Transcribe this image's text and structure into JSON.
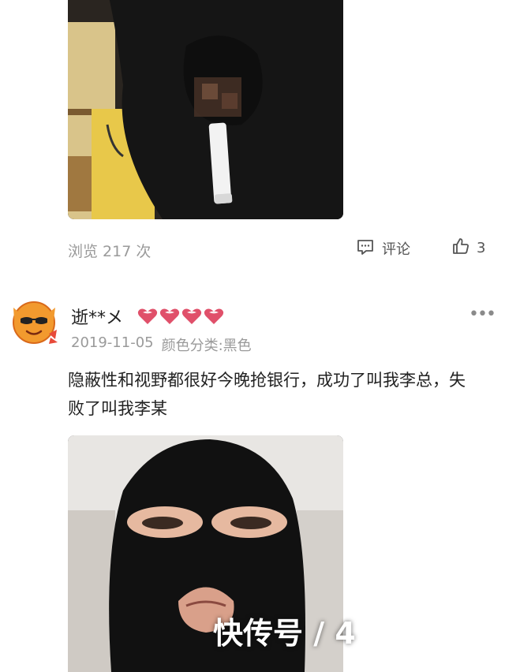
{
  "post": {
    "views_label": "浏览 217 次",
    "comment_label": "评论",
    "like_count": "3"
  },
  "review": {
    "username": "逝**メ",
    "hearts_count": 4,
    "date": "2019-11-05",
    "variant_label": "颜色分类:黑色",
    "text": "隐蔽性和视野都很好今晚抢银行，成功了叫我李总，失败了叫我李某"
  },
  "watermark": "快传号 / 4",
  "colors": {
    "heart": "#e0506a",
    "muted_text": "#9a9a9a",
    "body_text": "#222222"
  }
}
